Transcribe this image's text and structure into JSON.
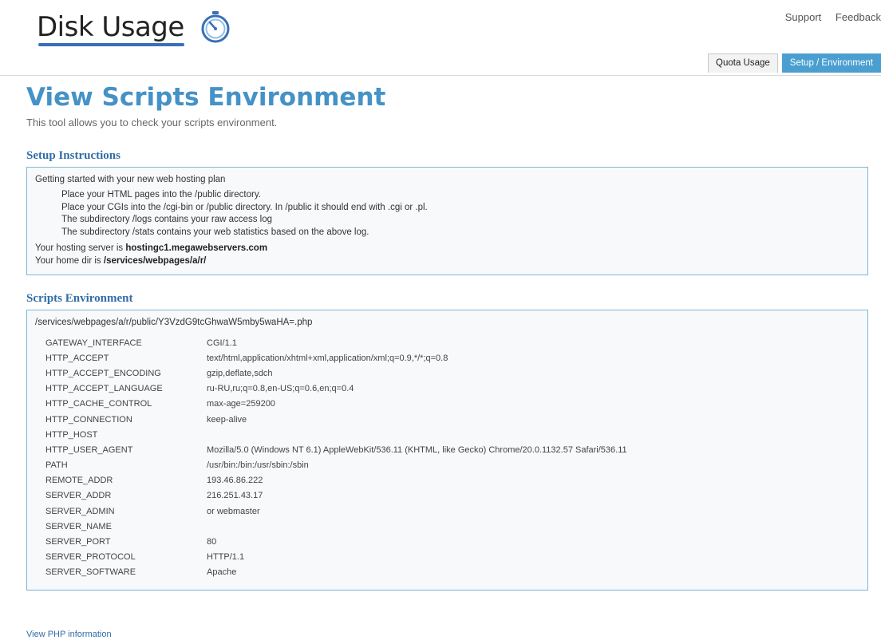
{
  "header": {
    "logo_text": "Disk Usage",
    "logo_icon": "stopwatch-icon",
    "brand_color": "#3a6fb5",
    "links": {
      "support": "Support",
      "feedback": "Feedback"
    },
    "tabs": [
      {
        "label": "Quota Usage",
        "active": false
      },
      {
        "label": "Setup / Environment",
        "active": true
      }
    ],
    "active_tab_color": "#4a9fd0"
  },
  "page": {
    "title": "View Scripts Environment",
    "subtitle": "This tool allows you to check your scripts environment.",
    "title_color": "#4592c6"
  },
  "setup": {
    "title": "Setup Instructions",
    "intro": "Getting started with your new web hosting plan",
    "steps": [
      "Place your HTML pages into the /public directory.",
      "Place your CGIs into the /cgi-bin or /public directory. In /public it should end with .cgi or .pl.",
      "The subdirectory /logs contains your raw access log",
      "The subdirectory /stats contains your web statistics based on the above log."
    ],
    "server_label": "Your hosting server is ",
    "server_value": "hostingc1.megawebservers.com",
    "homedir_label": "Your home dir is ",
    "homedir_value": "/services/webpages/a/r/"
  },
  "env": {
    "title": "Scripts Environment",
    "path": "/services/webpages/a/r/public/Y3VzdG9tcGhwaW5mby5waHA=.php",
    "rows": [
      {
        "key": "GATEWAY_INTERFACE",
        "value": "CGI/1.1"
      },
      {
        "key": "HTTP_ACCEPT",
        "value": "text/html,application/xhtml+xml,application/xml;q=0.9,*/*;q=0.8"
      },
      {
        "key": "HTTP_ACCEPT_ENCODING",
        "value": "gzip,deflate,sdch"
      },
      {
        "key": "HTTP_ACCEPT_LANGUAGE",
        "value": "ru-RU,ru;q=0.8,en-US;q=0.6,en;q=0.4"
      },
      {
        "key": "HTTP_CACHE_CONTROL",
        "value": "max-age=259200"
      },
      {
        "key": "HTTP_CONNECTION",
        "value": "keep-alive"
      },
      {
        "key": "HTTP_HOST",
        "value": ""
      },
      {
        "key": "HTTP_USER_AGENT",
        "value": "Mozilla/5.0 (Windows NT 6.1) AppleWebKit/536.11 (KHTML, like Gecko) Chrome/20.0.1132.57 Safari/536.11"
      },
      {
        "key": "PATH",
        "value": "/usr/bin:/bin:/usr/sbin:/sbin"
      },
      {
        "key": "REMOTE_ADDR",
        "value": "193.46.86.222"
      },
      {
        "key": "SERVER_ADDR",
        "value": "216.251.43.17"
      },
      {
        "key": "SERVER_ADMIN",
        "value": "or webmaster"
      },
      {
        "key": "SERVER_NAME",
        "value": ""
      },
      {
        "key": "SERVER_PORT",
        "value": "80"
      },
      {
        "key": "SERVER_PROTOCOL",
        "value": "HTTP/1.1"
      },
      {
        "key": "SERVER_SOFTWARE",
        "value": "Apache"
      }
    ]
  },
  "footer": {
    "php_info_link": "View PHP information"
  }
}
